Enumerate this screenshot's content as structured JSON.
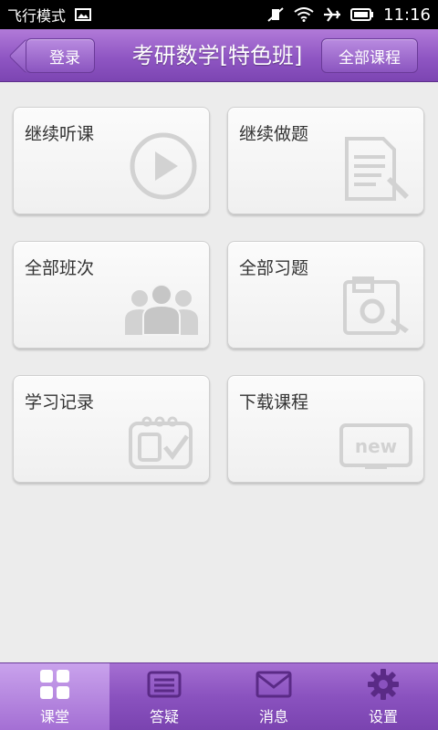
{
  "status_bar": {
    "mode_label": "飞行模式",
    "time": "11:16"
  },
  "header": {
    "back_label": "登录",
    "title": "考研数学[特色班]",
    "all_courses_label": "全部课程"
  },
  "tiles": [
    {
      "label": "继续听课",
      "icon": "play-icon"
    },
    {
      "label": "继续做题",
      "icon": "document-edit-icon"
    },
    {
      "label": "全部班次",
      "icon": "people-group-icon"
    },
    {
      "label": "全部习题",
      "icon": "camera-note-icon"
    },
    {
      "label": "学习记录",
      "icon": "calendar-check-icon"
    },
    {
      "label": "下载课程",
      "icon": "new-monitor-icon"
    }
  ],
  "new_badge_text": "new",
  "bottom_nav": [
    {
      "label": "课堂",
      "icon": "grid-icon",
      "active": true
    },
    {
      "label": "答疑",
      "icon": "list-icon",
      "active": false
    },
    {
      "label": "消息",
      "icon": "envelope-icon",
      "active": false
    },
    {
      "label": "设置",
      "icon": "gear-icon",
      "active": false
    }
  ],
  "colors": {
    "header_purple": "#8f56c3",
    "nav_purple": "#8a52bf",
    "background": "#ececec",
    "tile_icon_gray": "#d2d2d2"
  }
}
